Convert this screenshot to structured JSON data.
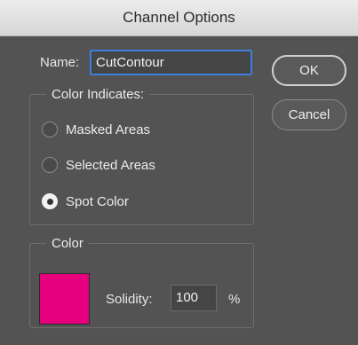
{
  "window": {
    "title": "Channel Options"
  },
  "name_field": {
    "label": "Name:",
    "value": "CutContour"
  },
  "buttons": {
    "ok": "OK",
    "cancel": "Cancel"
  },
  "color_indicates": {
    "legend": "Color Indicates:",
    "options": [
      {
        "label": "Masked Areas",
        "selected": false
      },
      {
        "label": "Selected Areas",
        "selected": false
      },
      {
        "label": "Spot Color",
        "selected": true
      }
    ]
  },
  "color_group": {
    "legend": "Color",
    "swatch_color": "#e6007e",
    "solidity_label": "Solidity:",
    "solidity_value": "100",
    "solidity_unit": "%"
  }
}
